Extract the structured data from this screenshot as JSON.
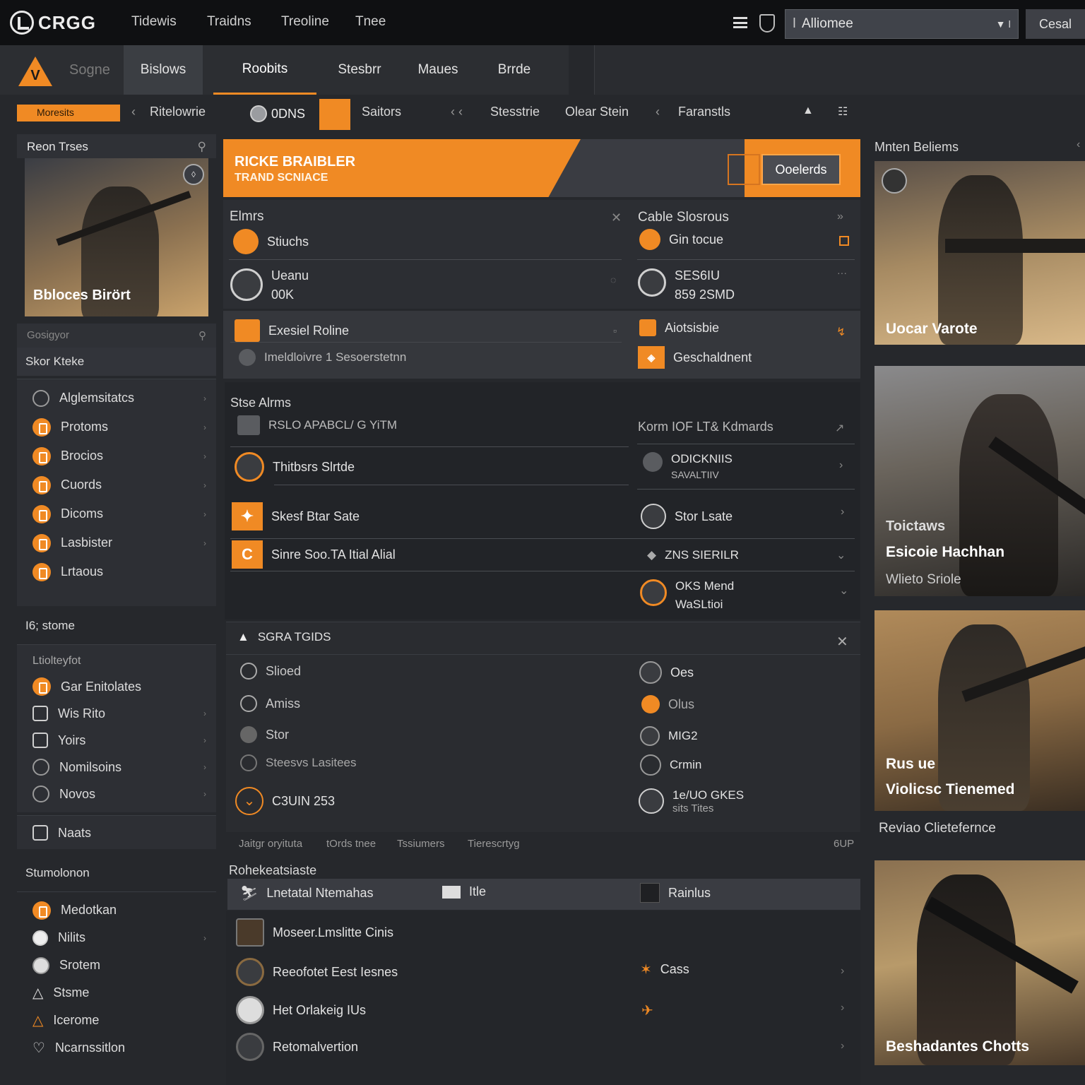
{
  "topbar": {
    "logo": "CRGG",
    "nav": [
      "Tidewis",
      "Traidns",
      "Treoline",
      "Tnee"
    ],
    "search_value": "Alliomee",
    "cancel": "Cesal"
  },
  "secondbar": {
    "badge": "V",
    "search_placeholder": "Sogne",
    "tabs": [
      "Bislows",
      "Roobits",
      "Stesbrr",
      "Maues",
      "Brrde"
    ]
  },
  "filterbar": {
    "chip": "Moresits",
    "items": [
      "Ritelowrie",
      "Saitors",
      "Stesstrie",
      "Olear Stein",
      "Faranstls"
    ],
    "code": "0DNS"
  },
  "left": {
    "card_title": "Reon Trses",
    "hero_caption": "Bbloces Birört",
    "sub_caption": "Gosigyor",
    "section1_title": "Skor Kteke",
    "section1_items": [
      "Alglemsitatcs",
      "Protoms",
      "Brocios",
      "Cuords",
      "Dicoms",
      "Lasbister",
      "Lrtaous"
    ],
    "section2_title": "I6; stome",
    "section2_subtitle": "Ltiolteyfot",
    "section2_items": [
      "Gar Enitolates",
      "Wis Rito",
      "Yoirs",
      "Nomilsoins",
      "Novos",
      "Naats"
    ],
    "section3_title": "Stumolonon",
    "section3_items": [
      "Medotkan",
      "Nilits",
      "Srotem",
      "Stsme",
      "Icerome",
      "Ncarnssitlon"
    ]
  },
  "banner": {
    "title": "RICKE BRAIBLER",
    "subtitle": "TRAND SCNIACE",
    "button": "Ooelerds"
  },
  "panel1": {
    "left_title": "Elmrs",
    "right_title": "Cable Slosrous",
    "rows": [
      {
        "left": "Stiuchs",
        "right": "Gin tocue"
      },
      {
        "left": "Ueanu",
        "left2": "00K",
        "right": "SES6IU",
        "right2": "859 2SMD"
      }
    ]
  },
  "panel2": {
    "left1": "Exesiel Roline",
    "left2": "Imeldloivre 1 Sesoerstetnn",
    "right1": "Aiotsisbie",
    "right2": "Geschaldnent"
  },
  "panel3": {
    "title": "Stse Alrms",
    "header_left": "RSLO APABCL/ G YiTM",
    "header_right": "Korm IOF LT& Kdmards",
    "rows_left": [
      "Thitbsrs Slrtde",
      "Skesf Btar Sate",
      "Sinre Soo.TA Itial Alial"
    ],
    "rows_right": [
      "ODICKNIIS",
      "Stor Lsate",
      "ZNS SIERILR",
      "OKS Mend"
    ],
    "rows_right_sub": [
      "SAVALTIIV",
      "",
      "",
      "WaSLtioi"
    ]
  },
  "panel4": {
    "title": "SGRA TGIDS",
    "left": [
      "Slioed",
      "Amiss",
      "Stor",
      "Steesvs Lasitees",
      "C3UIN 253"
    ],
    "right": [
      "Oes",
      "Olus",
      "MIG2",
      "Crmin",
      "1e/UO GKES"
    ],
    "right_sub": "sits Tites"
  },
  "footnote": [
    "Jaitgr oryituta",
    "tOrds tnee",
    "Tssiumers",
    "Tierescrtyg",
    "6UP"
  ],
  "panel5": {
    "title": "Rohekeatsiaste",
    "tabs": [
      "Lnetatal Ntemahas",
      "Itle",
      "Rainlus"
    ],
    "rows_left": [
      "Moseer.Lmslitte Cinis",
      "Reeofotet Eest Iesnes",
      "Het Orlakeig IUs",
      "Retomalvertion"
    ],
    "right": "Cass"
  },
  "right": {
    "header": "Mnten Beliems",
    "cards": [
      {
        "line1": "Uocar Varote"
      },
      {
        "line0": "Toictaws",
        "line1": "Esicoie Hachhan",
        "line2": "Wlieto Sriole"
      },
      {
        "line1": "Rus ue",
        "line2": "Violicsc Tienemed"
      },
      {
        "line1": "Beshadantes Chotts"
      }
    ],
    "between": "Reviao Clietefernce"
  },
  "colors": {
    "accent": "#f08a24",
    "bg": "#26282c",
    "panel": "#2c2e33"
  }
}
